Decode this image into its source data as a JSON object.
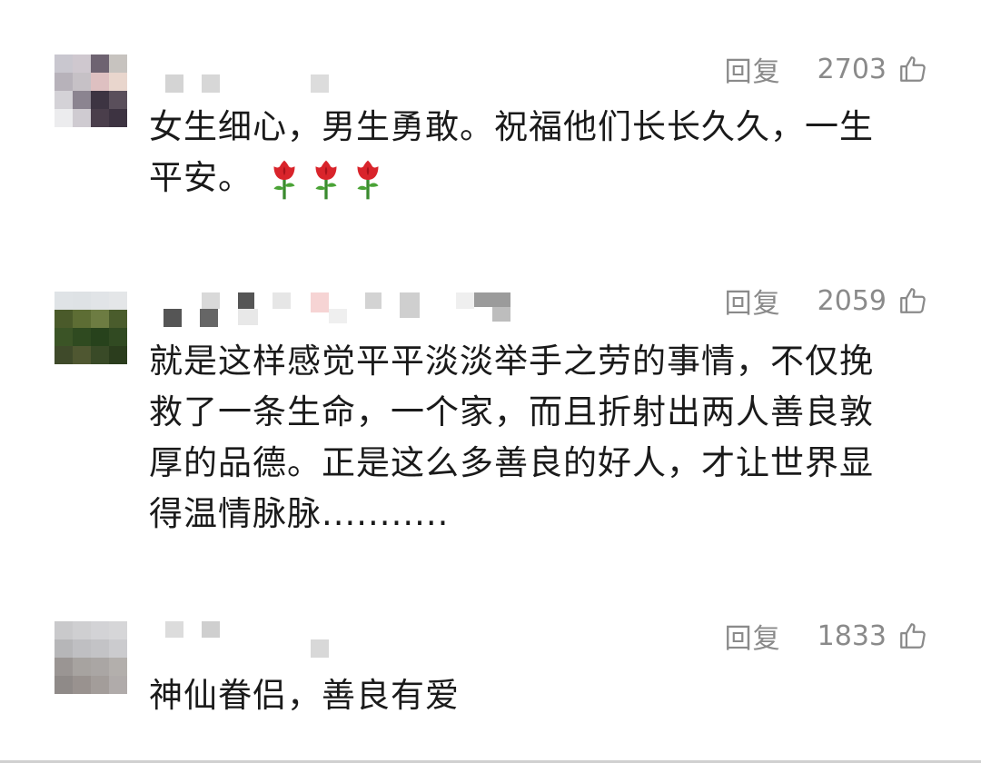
{
  "comments": [
    {
      "reply_label": "回复",
      "likes": "2703",
      "lines": [
        "女生细心，男生勇敢。祝福他们长长久久，一生",
        "平安。"
      ],
      "emoji": [
        "rose-icon",
        "rose-icon",
        "rose-icon"
      ]
    },
    {
      "reply_label": "回复",
      "likes": "2059",
      "lines": [
        "就是这样感觉平平淡淡举手之劳的事情，不仅挽",
        "救了一条生命，一个家，而且折射出两人善良敦",
        "厚的品德。正是这么多善良的好人，才让世界显",
        "得温情脉脉..........."
      ]
    },
    {
      "reply_label": "回复",
      "likes": "1833",
      "lines": [
        "神仙眷侣，善良有爱"
      ]
    }
  ],
  "colors": {
    "meta_text": "#8a8a8a",
    "body_text": "#1a1a1a"
  }
}
